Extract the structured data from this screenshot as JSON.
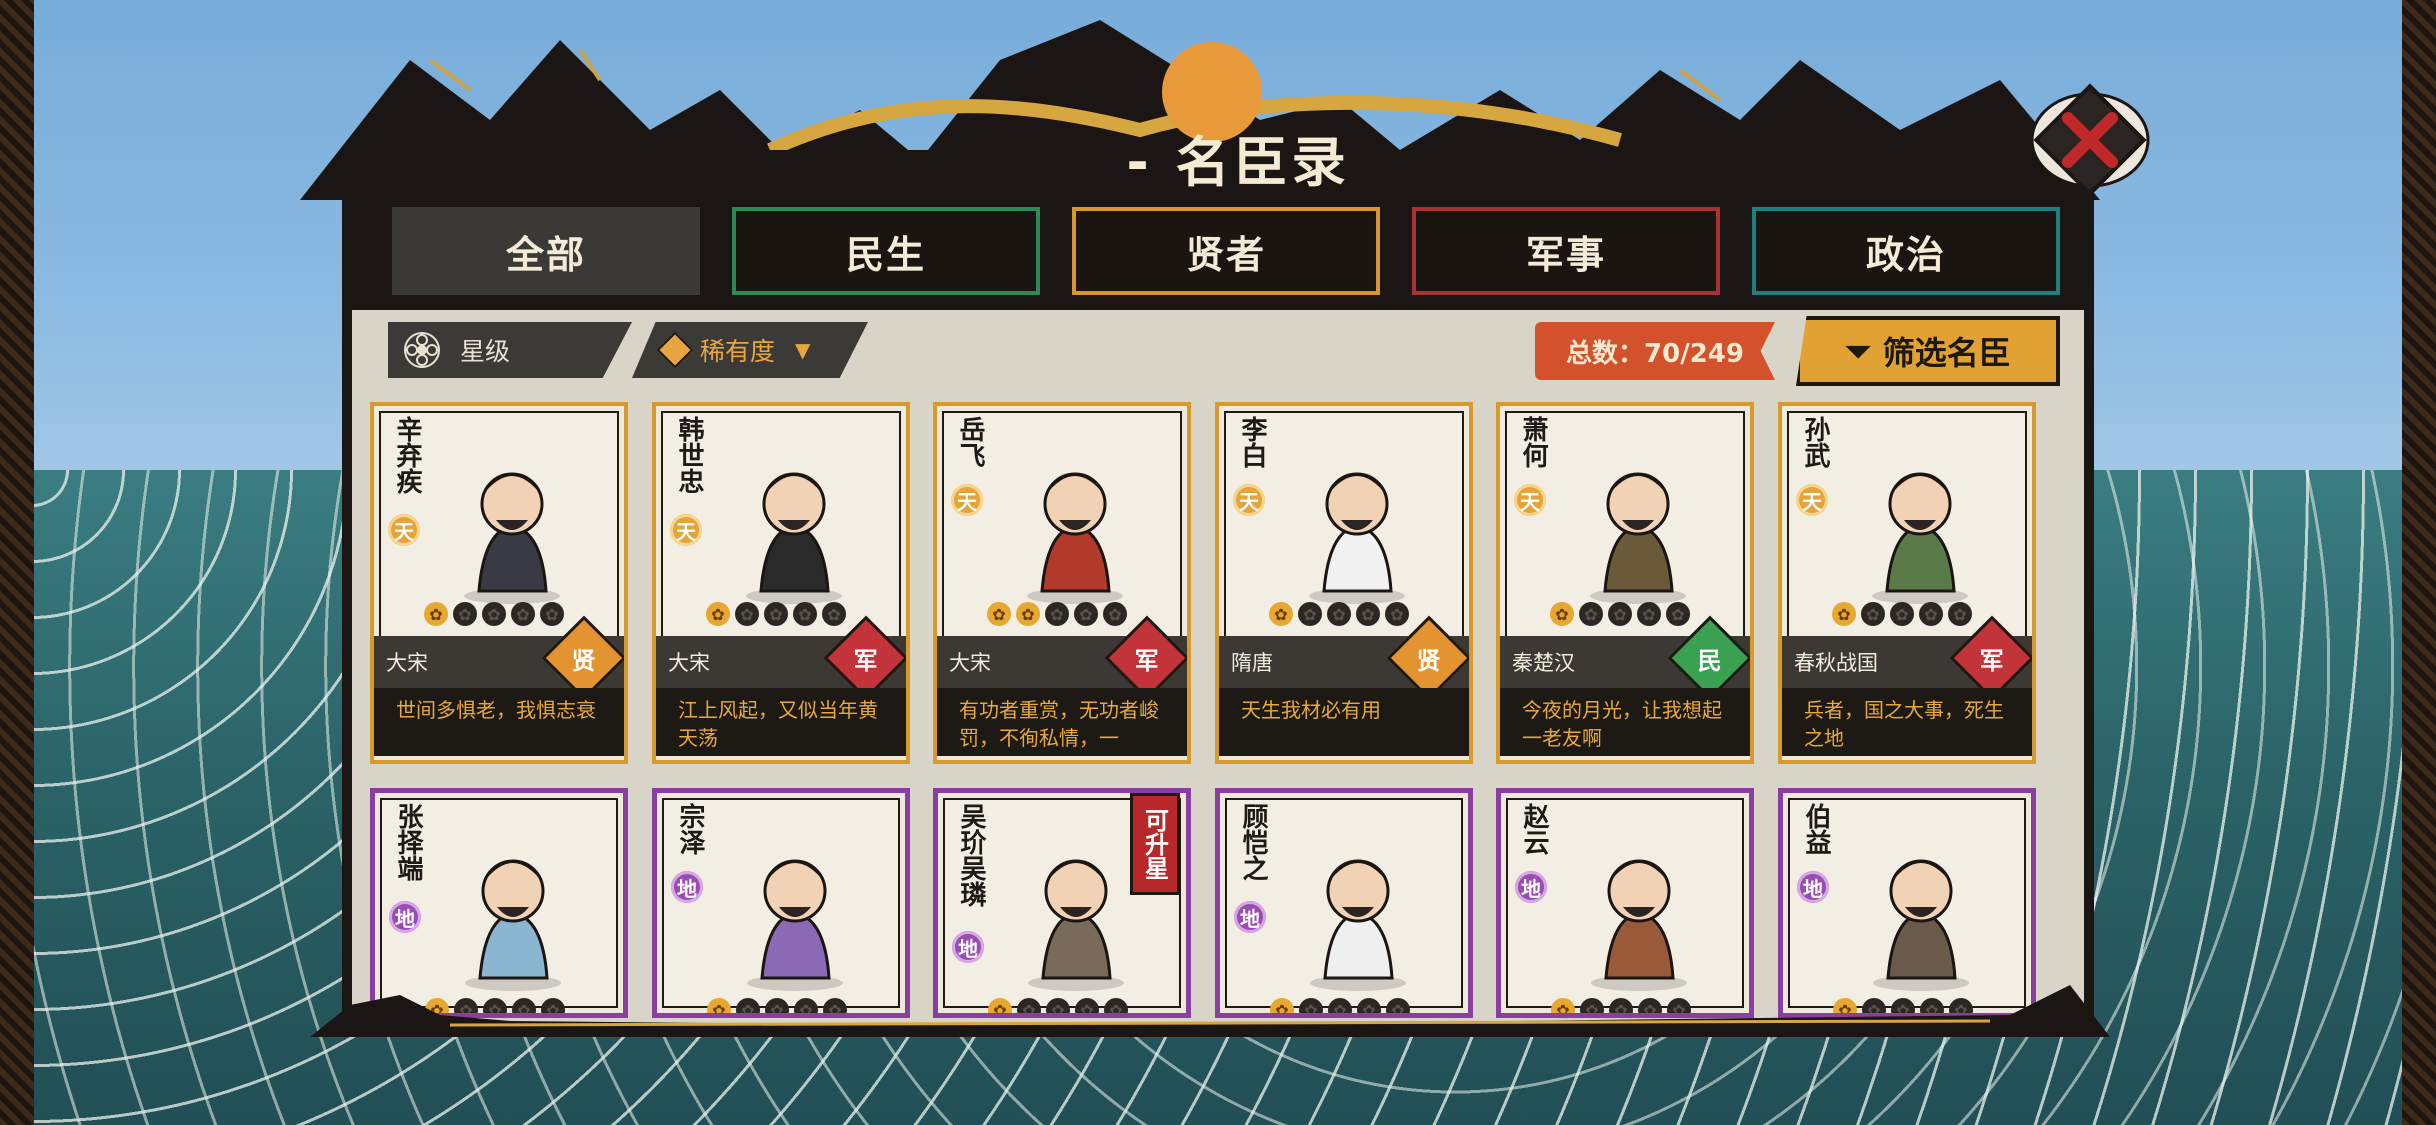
{
  "title": "- 名臣录 -",
  "close_icon": "close-x-icon",
  "tabs": [
    {
      "label": "全部",
      "active": true,
      "border": "#3b3936"
    },
    {
      "label": "民生",
      "active": false,
      "border": "#2e8a55"
    },
    {
      "label": "贤者",
      "active": false,
      "border": "#d8962c"
    },
    {
      "label": "军事",
      "active": false,
      "border": "#a83236"
    },
    {
      "label": "政治",
      "active": false,
      "border": "#1f7f7e"
    }
  ],
  "sort": {
    "star_label": "星级",
    "rarity_label": "稀有度"
  },
  "total": "总数：70/249",
  "filter_label": "筛选名臣",
  "colors": {
    "gold_border": "#d89a2b",
    "purple_border": "#8a3fa0",
    "type_xian": "#e3932f",
    "type_jun": "#c2333a",
    "type_min": "#3aa052"
  },
  "cards": [
    {
      "name": "辛弃疾",
      "grade": "天",
      "stars": 1,
      "era": "大宋",
      "type": "贤",
      "quote": "世间多惧老，我惧志衰"
    },
    {
      "name": "韩世忠",
      "grade": "天",
      "stars": 1,
      "era": "大宋",
      "type": "军",
      "quote": "江上风起，又似当年黄天荡"
    },
    {
      "name": "岳飞",
      "grade": "天",
      "stars": 2,
      "era": "大宋",
      "type": "军",
      "quote": "有功者重赏，无功者峻罚，不徇私情，一"
    },
    {
      "name": "李白",
      "grade": "天",
      "stars": 1,
      "era": "隋唐",
      "type": "贤",
      "quote": "天生我材必有用"
    },
    {
      "name": "萧何",
      "grade": "天",
      "stars": 1,
      "era": "秦楚汉",
      "type": "民",
      "quote": "今夜的月光，让我想起一老友啊"
    },
    {
      "name": "孙武",
      "grade": "天",
      "stars": 1,
      "era": "春秋战国",
      "type": "军",
      "quote": "兵者，国之大事，死生之地"
    },
    {
      "name": "张择端",
      "grade": "地"
    },
    {
      "name": "宗泽",
      "grade": "地"
    },
    {
      "name": "吴玠吴璘",
      "grade": "地",
      "badge": "可升星"
    },
    {
      "name": "顾恺之",
      "grade": "地"
    },
    {
      "name": "赵云",
      "grade": "地"
    },
    {
      "name": "伯益",
      "grade": "地"
    }
  ]
}
